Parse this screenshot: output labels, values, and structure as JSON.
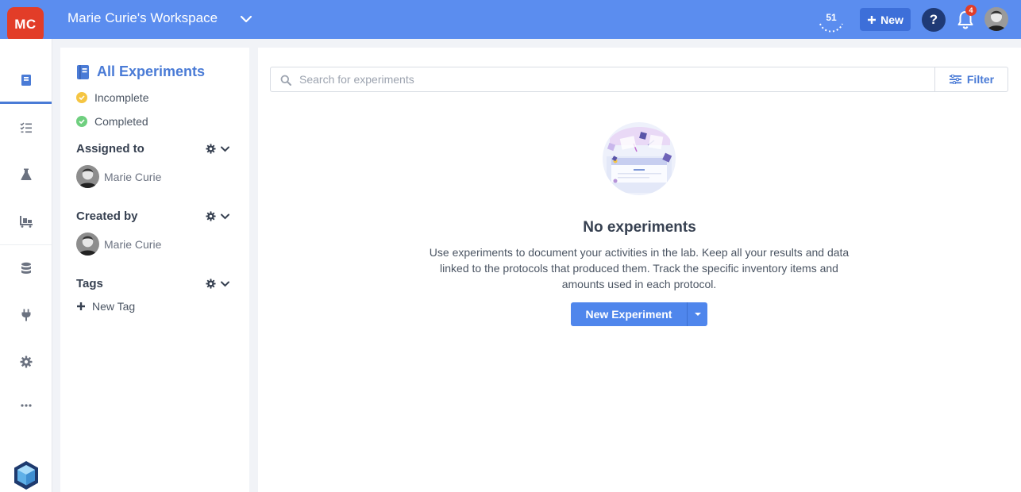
{
  "colors": {
    "topbar": "#5b8def",
    "accent": "#4a7bd6",
    "logo": "#e23d28",
    "primary_button": "#4f86ec"
  },
  "header": {
    "logo_text": "MC",
    "workspace_title": "Marie Curie's Workspace",
    "counter": "51",
    "new_button_label": "New",
    "help_label": "?",
    "notification_count": "4"
  },
  "rail": {
    "items": [
      {
        "icon": "notebook-icon"
      },
      {
        "icon": "checklist-icon"
      },
      {
        "icon": "flask-icon"
      },
      {
        "icon": "inventory-icon"
      },
      {
        "icon": "database-icon"
      },
      {
        "icon": "plug-icon"
      },
      {
        "icon": "gear-icon"
      },
      {
        "icon": "more-icon"
      }
    ]
  },
  "sidebar": {
    "title": "All Experiments",
    "statuses": [
      {
        "label": "Incomplete",
        "color": "#f5c542"
      },
      {
        "label": "Completed",
        "color": "#6fcf7f"
      }
    ],
    "sections": {
      "assigned_to": {
        "title": "Assigned to",
        "person": "Marie Curie"
      },
      "created_by": {
        "title": "Created by",
        "person": "Marie Curie"
      },
      "tags": {
        "title": "Tags",
        "new_tag_label": "New Tag"
      }
    }
  },
  "main": {
    "search_placeholder": "Search for experiments",
    "filter_label": "Filter",
    "empty": {
      "title": "No experiments",
      "description": "Use experiments to document your activities in the lab. Keep all your results and data linked to the protocols that produced them. Track the specific inventory items and amounts used in each protocol.",
      "button_label": "New Experiment"
    }
  }
}
